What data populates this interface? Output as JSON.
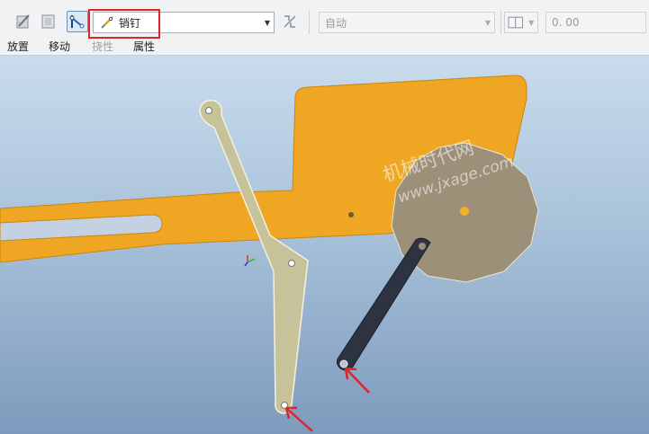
{
  "toolbar": {
    "connection_type": "销钉",
    "mode_value": "自动",
    "numeric_value": "0. 00",
    "tabs": {
      "placement": "放置",
      "move": "移动",
      "flexibility": "挠性",
      "properties": "属性"
    },
    "highlight_color": "#e0242c"
  },
  "viewport": {
    "watermark_cn": "机械时代网",
    "watermark_url": "www.jxage.com",
    "colors": {
      "plate": "#efa622",
      "disc": "#9c9078",
      "link_left": "#c6c29a",
      "link_dark": "#2d3341",
      "arrow": "#e0242c"
    }
  }
}
